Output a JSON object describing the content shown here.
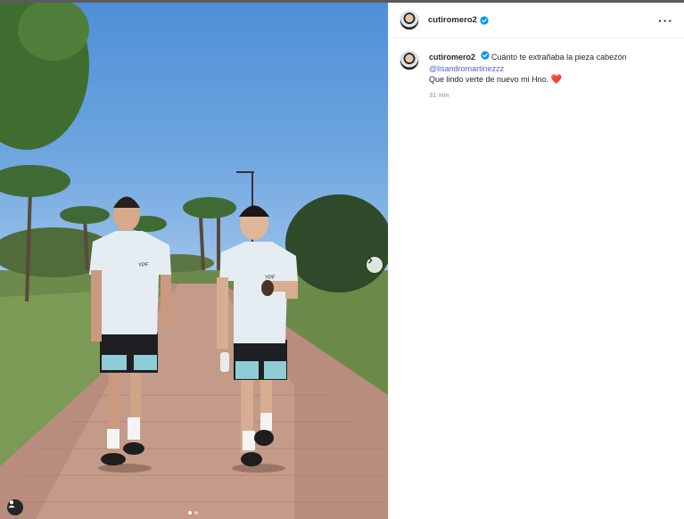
{
  "post": {
    "username": "cutiromero2",
    "more_icon": "more-horizontal-icon",
    "verified_color": "#0095f6"
  },
  "comment": {
    "username": "cutiromero2",
    "text_line1": "Cuánto te extrañaba la pieza cabezón",
    "mention": "@lisandromartinezzz",
    "text_line2": "Que lindo verte de nuevo mi Hno.",
    "emoji": "❤️",
    "timestamp": "31 min"
  },
  "photo": {
    "carousel_total": 2,
    "carousel_active": 1,
    "jersey_sponsor_left": "YPF",
    "jersey_sponsor_right": "YPF"
  }
}
